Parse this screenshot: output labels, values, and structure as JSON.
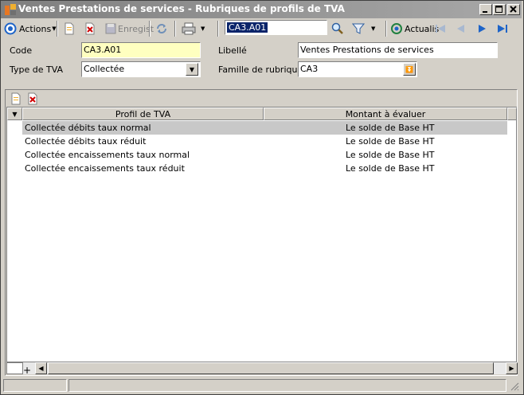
{
  "window": {
    "title": "Ventes Prestations de services -  Rubriques de profils de TVA"
  },
  "toolbar": {
    "actions_label": "Actions",
    "save_label": "Enregist",
    "search_value": "CA3.A01",
    "refresh_label": "Actualis"
  },
  "form": {
    "code_label": "Code",
    "code_value": "CA3.A01",
    "libelle_label": "Libellé",
    "libelle_value": "Ventes Prestations de services",
    "type_tva_label": "Type de TVA",
    "type_tva_value": "Collectée",
    "famille_label": "Famille de rubrique",
    "famille_value": "CA3"
  },
  "grid": {
    "columns": [
      "Profil de TVA",
      "Montant à évaluer"
    ],
    "rows": [
      {
        "profil": "Collectée débits taux normal",
        "montant": "Le solde de Base HT"
      },
      {
        "profil": "Collectée débits taux réduit",
        "montant": "Le solde de Base HT"
      },
      {
        "profil": "Collectée encaissements taux normal",
        "montant": "Le solde de Base HT"
      },
      {
        "profil": "Collectée encaissements taux réduit",
        "montant": "Le solde de Base HT"
      }
    ]
  },
  "colors": {
    "title_bar": "#a8a8a8",
    "code_field_bg": "#ffffc0",
    "selected_row": "#c8c8c8",
    "nav_arrow": "#1e64c8"
  }
}
